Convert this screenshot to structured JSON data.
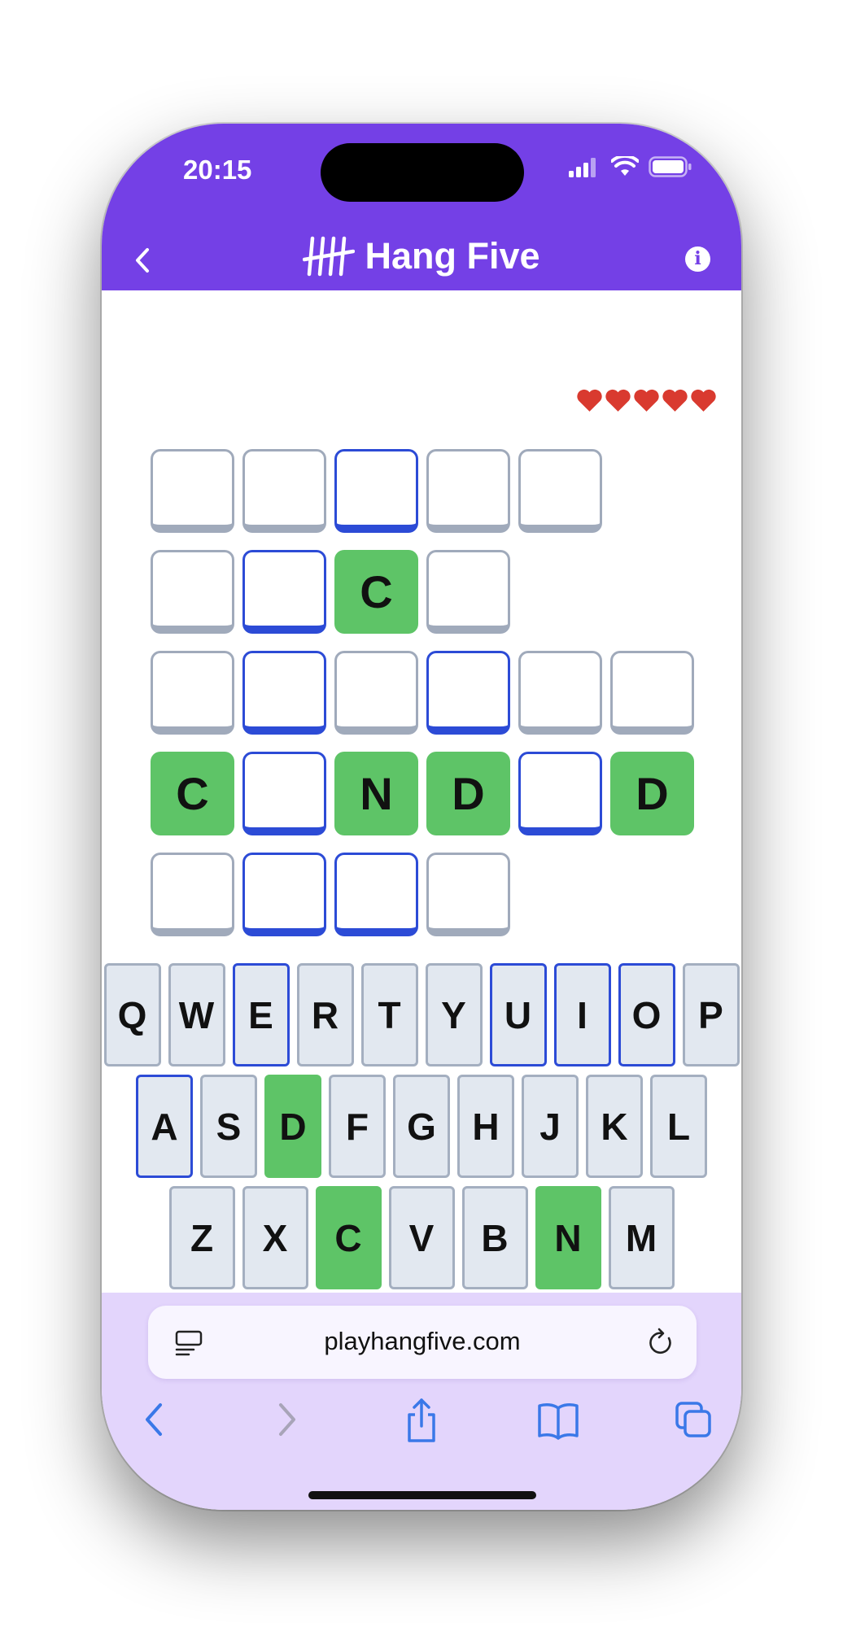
{
  "status_bar": {
    "time": "20:15"
  },
  "header": {
    "title": "Hang Five",
    "back_icon": "chevron-left-icon",
    "logo_icon": "tally-marks-icon",
    "info_icon": "info-icon"
  },
  "lives": {
    "remaining": 5,
    "total": 5,
    "icon": "heart-icon",
    "color": "#d93a2f"
  },
  "colors": {
    "header_bg": "#7440e6",
    "found": "#5ec467",
    "vowel_outline": "#2c4bd6",
    "blank_outline": "#a0aabb",
    "browser_bg": "#e3d5fc"
  },
  "board": {
    "rows": [
      [
        {
          "letter": "",
          "state": "blank"
        },
        {
          "letter": "",
          "state": "blank"
        },
        {
          "letter": "",
          "state": "vowel"
        },
        {
          "letter": "",
          "state": "blank"
        },
        {
          "letter": "",
          "state": "blank"
        }
      ],
      [
        {
          "letter": "",
          "state": "blank"
        },
        {
          "letter": "",
          "state": "vowel"
        },
        {
          "letter": "C",
          "state": "found"
        },
        {
          "letter": "",
          "state": "blank"
        }
      ],
      [
        {
          "letter": "",
          "state": "blank"
        },
        {
          "letter": "",
          "state": "vowel"
        },
        {
          "letter": "",
          "state": "blank"
        },
        {
          "letter": "",
          "state": "vowel"
        },
        {
          "letter": "",
          "state": "blank"
        },
        {
          "letter": "",
          "state": "blank"
        }
      ],
      [
        {
          "letter": "C",
          "state": "found"
        },
        {
          "letter": "",
          "state": "vowel"
        },
        {
          "letter": "N",
          "state": "found"
        },
        {
          "letter": "D",
          "state": "found"
        },
        {
          "letter": "",
          "state": "vowel"
        },
        {
          "letter": "D",
          "state": "found"
        }
      ],
      [
        {
          "letter": "",
          "state": "blank"
        },
        {
          "letter": "",
          "state": "vowel"
        },
        {
          "letter": "",
          "state": "vowel"
        },
        {
          "letter": "",
          "state": "blank"
        }
      ]
    ]
  },
  "keyboard": {
    "rows": [
      [
        {
          "key": "Q",
          "state": "normal"
        },
        {
          "key": "W",
          "state": "normal"
        },
        {
          "key": "E",
          "state": "vowel"
        },
        {
          "key": "R",
          "state": "normal"
        },
        {
          "key": "T",
          "state": "normal"
        },
        {
          "key": "Y",
          "state": "normal"
        },
        {
          "key": "U",
          "state": "vowel"
        },
        {
          "key": "I",
          "state": "vowel"
        },
        {
          "key": "O",
          "state": "vowel"
        },
        {
          "key": "P",
          "state": "normal"
        }
      ],
      [
        {
          "key": "A",
          "state": "vowel"
        },
        {
          "key": "S",
          "state": "normal"
        },
        {
          "key": "D",
          "state": "found"
        },
        {
          "key": "F",
          "state": "normal"
        },
        {
          "key": "G",
          "state": "normal"
        },
        {
          "key": "H",
          "state": "normal"
        },
        {
          "key": "J",
          "state": "normal"
        },
        {
          "key": "K",
          "state": "normal"
        },
        {
          "key": "L",
          "state": "normal"
        }
      ],
      [
        {
          "key": "Z",
          "state": "normal"
        },
        {
          "key": "X",
          "state": "normal"
        },
        {
          "key": "C",
          "state": "found"
        },
        {
          "key": "V",
          "state": "normal"
        },
        {
          "key": "B",
          "state": "normal"
        },
        {
          "key": "N",
          "state": "found"
        },
        {
          "key": "M",
          "state": "normal"
        }
      ]
    ]
  },
  "browser": {
    "url": "playhangfive.com",
    "toolbar": [
      "back-icon",
      "forward-icon",
      "share-icon",
      "bookmarks-icon",
      "tabs-icon"
    ]
  }
}
